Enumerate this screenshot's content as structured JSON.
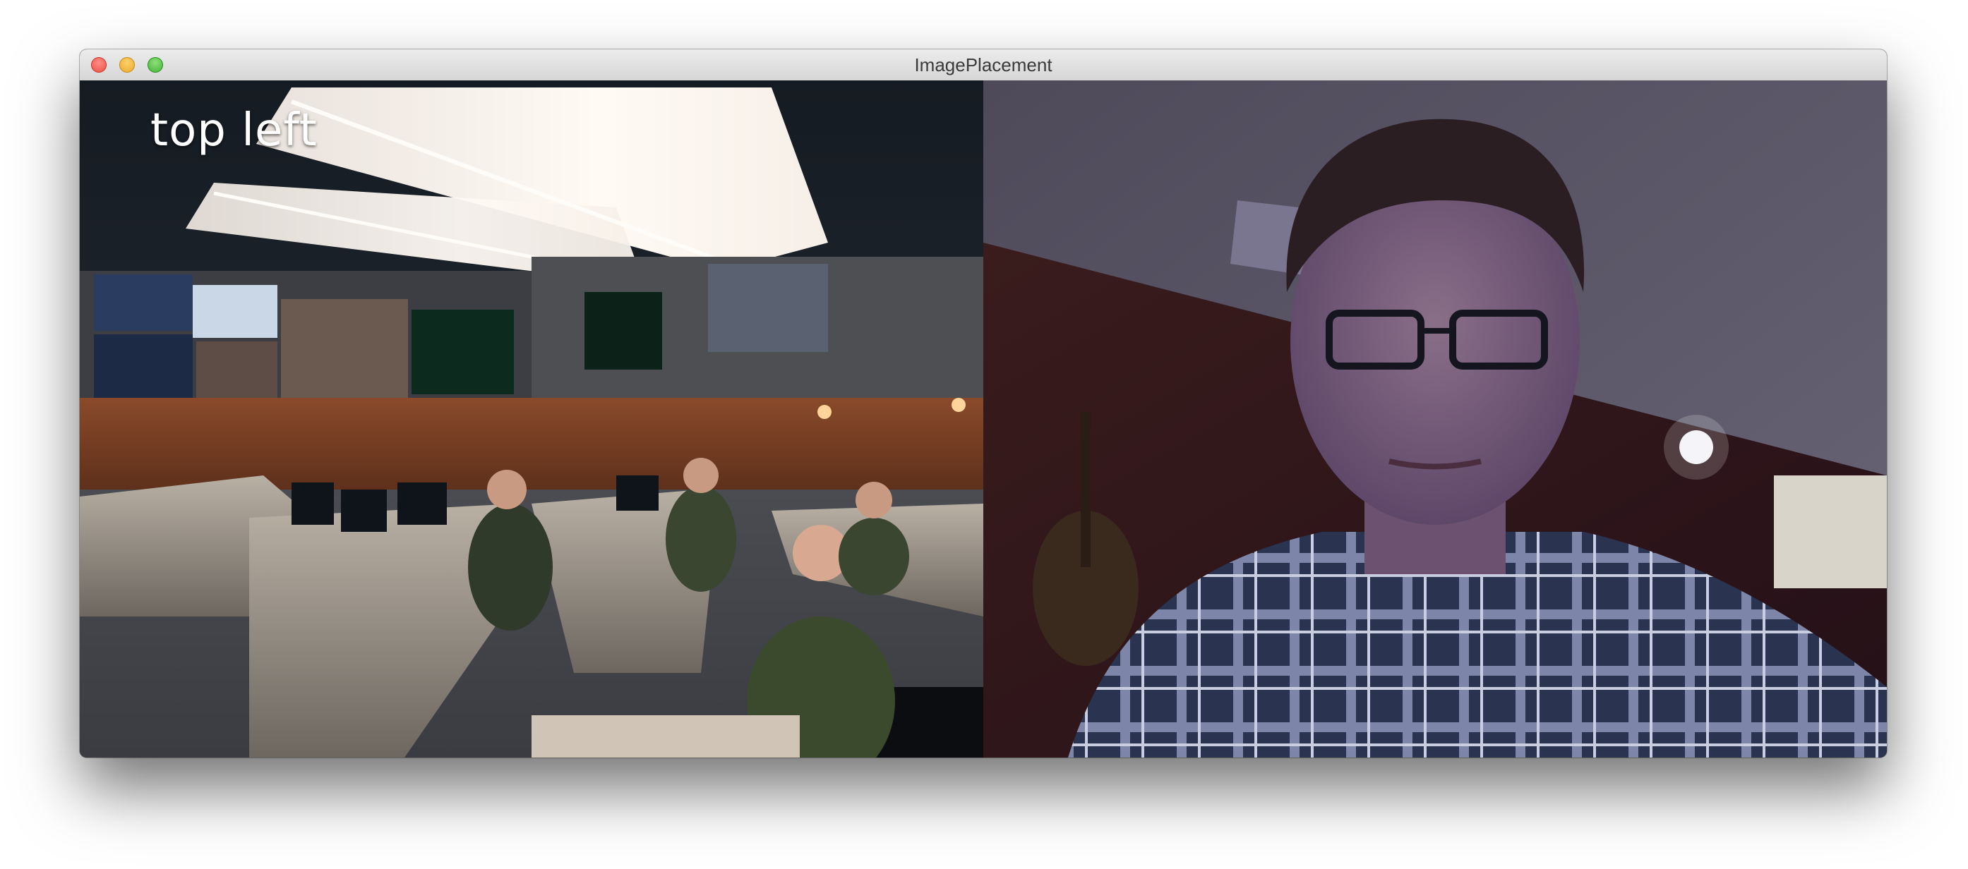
{
  "window": {
    "title": "ImagePlacement",
    "controls": [
      "close-button",
      "minimize-button",
      "zoom-button"
    ]
  },
  "left_image": {
    "label": "top left",
    "subject": "operations-control-room-photo"
  },
  "right_image": {
    "subject": "webcam-portrait-photo"
  },
  "colors": {
    "titlebar": "#e0e0e0",
    "label": "#ffffff"
  }
}
